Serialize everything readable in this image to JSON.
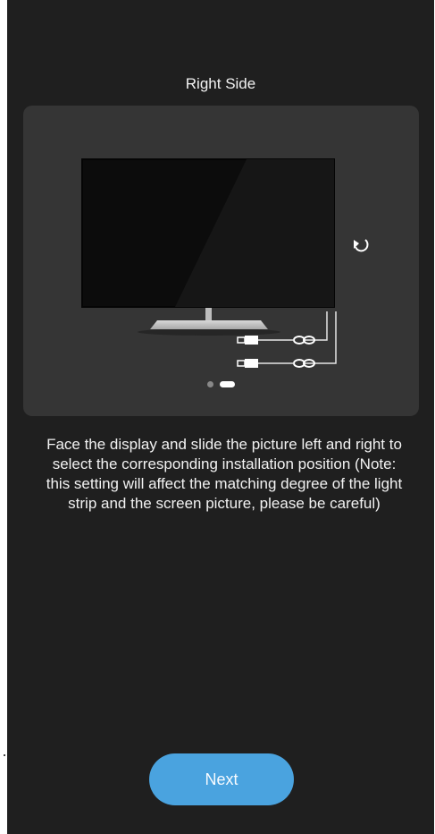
{
  "title": "Right Side",
  "description": "Face the display and slide the picture left and right to select the corresponding installation position (Note: this setting will affect the matching degree of the light strip and the screen picture, please be careful)",
  "pager": {
    "total": 2,
    "active_index": 1
  },
  "next_button": {
    "label": "Next"
  },
  "colors": {
    "background": "#1f1f1f",
    "card": "#353535",
    "accent": "#4aa3df",
    "text": "#f2f2f2"
  },
  "icons": {
    "rotate": "rotate-arrow-icon",
    "usb_plug": "usb-plug-icon",
    "link": "link-loop-icon"
  }
}
